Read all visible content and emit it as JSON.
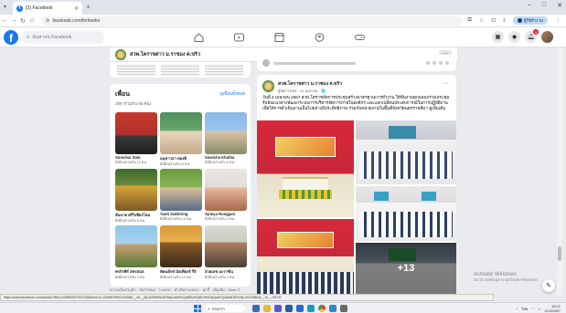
{
  "browser": {
    "tab_title": "(2) Facebook",
    "url": "facebook.com/forbooks",
    "profile_label": "ผู้ใช้ทำงาน",
    "window_controls": [
      "–",
      "□",
      "✕"
    ]
  },
  "fb": {
    "logo": "f",
    "search_placeholder": "ค้นหาบน Facebook",
    "nav_icons": [
      "home-icon",
      "video-icon",
      "marketplace-icon",
      "groups-icon",
      "gaming-icon"
    ],
    "notif_count": "3"
  },
  "page_header": {
    "name": "สวพ.โคราชต่าว ม.ราชมง ค.ขริว",
    "more": "···"
  },
  "friends": {
    "title": "เพื่อน",
    "count": "389 (ร่วมกัน 65 คน)",
    "see_all": "ดูเพื่อนทั้งหมด",
    "items": [
      {
        "name": "Somchai Sato",
        "mutual": "มีเพื่อนร่วมกัน 11 คน"
      },
      {
        "name": "อนุชาวลา ทองดี",
        "mutual": "มีเพื่อนร่วมกัน 9 คน"
      },
      {
        "name": "Suwicha Khatha",
        "mutual": "มีเพื่อนร่วมกัน 6 คน"
      },
      {
        "name": "สัมมาต ศรีวิเชียรโคม",
        "mutual": "มีเพื่อนร่วมกัน 8 คน"
      },
      {
        "name": "Yaoti Sukhiring",
        "mutual": "มีเพื่อนร่วมกัน 10 คน"
      },
      {
        "name": "Apinya Rongjam",
        "mutual": "มีเพื่อนร่วมกัน 4 คน"
      },
      {
        "name": "พรกิรพิร์ สหรสมล",
        "mutual": "มีเพื่อนร่วมกัน 3 คน"
      },
      {
        "name": "คิดมยักษ์ ม้อเที่ยงจ์ รี่จ์",
        "mutual": "มีเพื่อนร่วมกัน 14 คน"
      },
      {
        "name": "สวยเลข มะราฆิน",
        "mutual": "มีเพื่อนร่วมกัน 2 คน"
      }
    ],
    "footer": "ความเป็นส่วนตัว · ข้อกำหนด · โฆษณา · ตัวเลือกโฆษณา · คุกกี้ · เพิ่มเติม · Meta ©"
  },
  "post": {
    "author": "สวพ.โคราชต่าว ม.ราชมง ค.ขริว",
    "meta": "ผู้จัดการเพจ · 12 เมษายน · 🌐",
    "text": "วันที่ 4 เมษายน 2567 สวพ.โคราชจัดการประชุมสร้างมาตรฐานการทำงาน ให้ทีมงานทุกแผนกร่วมประชุมรับฟังแนวทางพัฒนาระบบการบริหารจัดการภายในองค์กร และแลกเปลี่ยนประสบการณ์ในการปฏิบัติงาน เพื่อให้การดำเนินงานเป็นไปอย่างมีประสิทธิภาพ ร่วมกับหน่วยงานในพื้นที่จังหวัดนครราชสีมา",
    "see_more": "ดูเพิ่มเติม",
    "more_count": "+13"
  },
  "windows": {
    "activate_title": "Activate Windows",
    "activate_sub": "Go to Settings to activate Windows.",
    "search_label": "Search",
    "time": "15:21",
    "date": "12/4/2567",
    "lang": "ไทย"
  },
  "status_url": "https://www.facebook.com/photo/?fbid=1448894579212345&set=a.1234567890123456&__cft__[0]=AZWk9sJzP8qLm0vRx2yNtBc4FgHj7eKlOpQwErTyUiAsDfGhJkLzXcVbNm&__tn__=EH-R"
}
